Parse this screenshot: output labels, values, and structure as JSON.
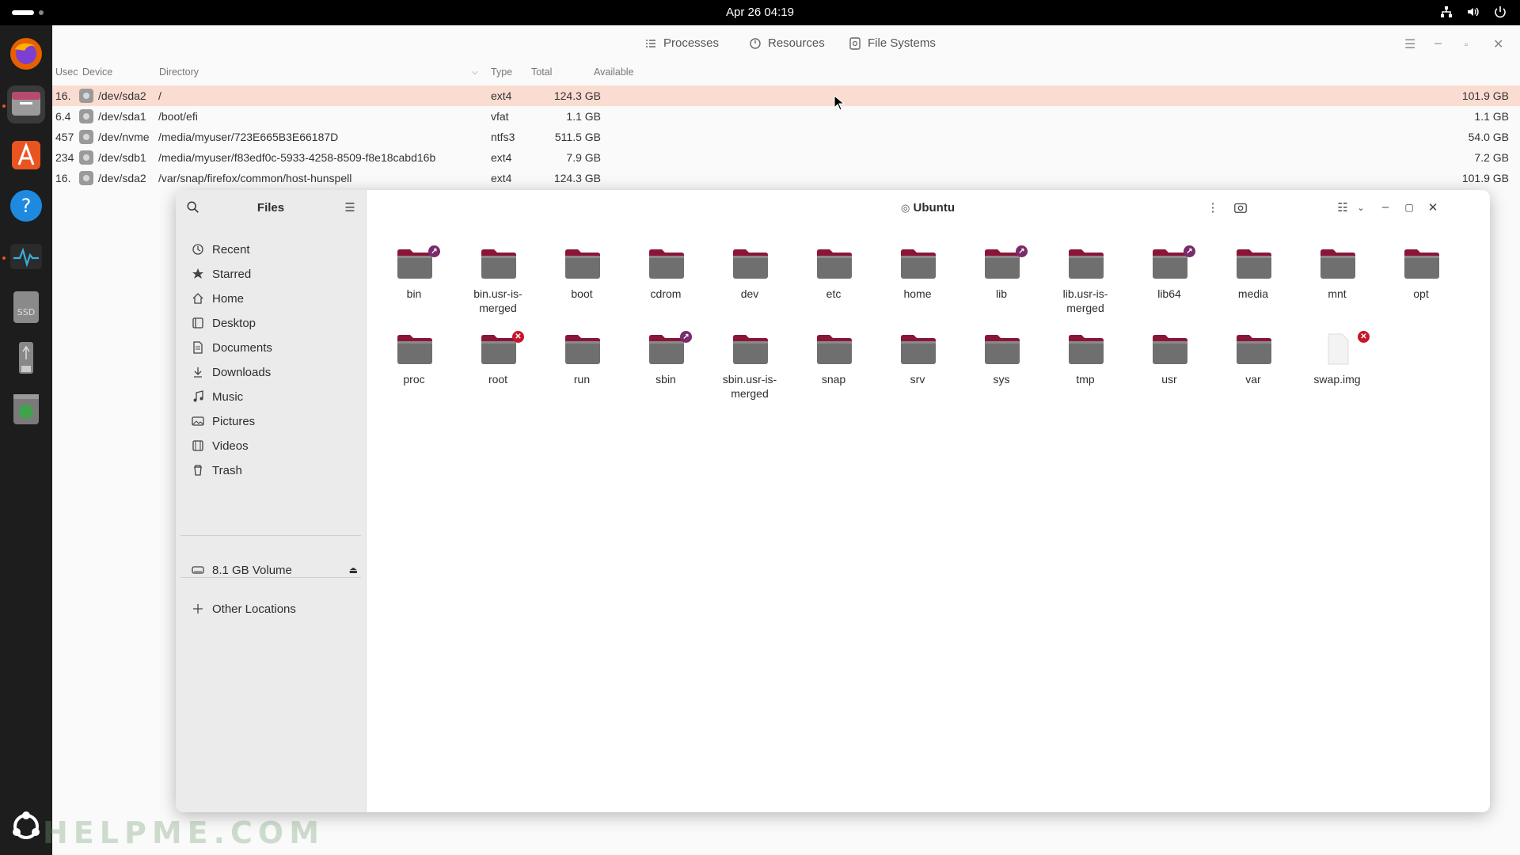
{
  "topbar": {
    "clock": "Apr 26  04:19"
  },
  "dock": {
    "items": [
      "firefox",
      "files",
      "app-center",
      "help",
      "system-monitor",
      "ssd-drive",
      "usb-drive",
      "trash"
    ]
  },
  "sysmon": {
    "tabs": [
      {
        "label": "Processes",
        "icon": "list-icon"
      },
      {
        "label": "Resources",
        "icon": "gauge-icon"
      },
      {
        "label": "File Systems",
        "icon": "disk-icon"
      }
    ],
    "columns": {
      "used": "Usec",
      "device": "Device",
      "directory": "Directory",
      "type": "Type",
      "total": "Total",
      "available": "Available"
    },
    "rows": [
      {
        "used": "16.",
        "device": "/dev/sda2",
        "directory": "/",
        "type": "ext4",
        "total": "124.3 GB",
        "available": "101.9 GB",
        "selected": true
      },
      {
        "used": "6.4",
        "device": "/dev/sda1",
        "directory": "/boot/efi",
        "type": "vfat",
        "total": "1.1 GB",
        "available": "1.1 GB",
        "selected": false
      },
      {
        "used": "457",
        "device": "/dev/nvme",
        "directory": "/media/myuser/723E665B3E66187D",
        "type": "ntfs3",
        "total": "511.5 GB",
        "available": "54.0 GB",
        "selected": false
      },
      {
        "used": "234",
        "device": "/dev/sdb1",
        "directory": "/media/myuser/f83edf0c-5933-4258-8509-f8e18cabd16b",
        "type": "ext4",
        "total": "7.9 GB",
        "available": "7.2 GB",
        "selected": false
      },
      {
        "used": "16.",
        "device": "/dev/sda2",
        "directory": "/var/snap/firefox/common/host-hunspell",
        "type": "ext4",
        "total": "124.3 GB",
        "available": "101.9 GB",
        "selected": false
      }
    ]
  },
  "files": {
    "sidebar_title": "Files",
    "location": "Ubuntu",
    "places": [
      {
        "label": "Recent",
        "icon": "clock-icon"
      },
      {
        "label": "Starred",
        "icon": "star-icon"
      },
      {
        "label": "Home",
        "icon": "home-icon"
      },
      {
        "label": "Desktop",
        "icon": "desktop-icon"
      },
      {
        "label": "Documents",
        "icon": "document-icon"
      },
      {
        "label": "Downloads",
        "icon": "download-icon"
      },
      {
        "label": "Music",
        "icon": "music-icon"
      },
      {
        "label": "Pictures",
        "icon": "picture-icon"
      },
      {
        "label": "Videos",
        "icon": "video-icon"
      },
      {
        "label": "Trash",
        "icon": "trash-icon"
      }
    ],
    "volume": "8.1 GB Volume",
    "other_locations": "Other Locations",
    "items": [
      {
        "name": "bin",
        "emblem": "link"
      },
      {
        "name": "bin.usr-is-merged",
        "emblem": ""
      },
      {
        "name": "boot",
        "emblem": ""
      },
      {
        "name": "cdrom",
        "emblem": ""
      },
      {
        "name": "dev",
        "emblem": ""
      },
      {
        "name": "etc",
        "emblem": ""
      },
      {
        "name": "home",
        "emblem": ""
      },
      {
        "name": "lib",
        "emblem": "link"
      },
      {
        "name": "lib.usr-is-merged",
        "emblem": ""
      },
      {
        "name": "lib64",
        "emblem": "link"
      },
      {
        "name": "media",
        "emblem": ""
      },
      {
        "name": "mnt",
        "emblem": ""
      },
      {
        "name": "opt",
        "emblem": ""
      },
      {
        "name": "proc",
        "emblem": ""
      },
      {
        "name": "root",
        "emblem": "lock"
      },
      {
        "name": "run",
        "emblem": ""
      },
      {
        "name": "sbin",
        "emblem": "link"
      },
      {
        "name": "sbin.usr-is-merged",
        "emblem": ""
      },
      {
        "name": "snap",
        "emblem": ""
      },
      {
        "name": "srv",
        "emblem": ""
      },
      {
        "name": "sys",
        "emblem": ""
      },
      {
        "name": "tmp",
        "emblem": ""
      },
      {
        "name": "usr",
        "emblem": ""
      },
      {
        "name": "var",
        "emblem": ""
      },
      {
        "name": "swap.img",
        "emblem": "lock",
        "kind": "file"
      }
    ]
  },
  "watermark": "HELPME.COM",
  "colors": {
    "accent": "#e95420",
    "folder_tab": "#8a1538",
    "folder_body": "#6f6f6f",
    "selected_row": "#fbdcd1"
  }
}
